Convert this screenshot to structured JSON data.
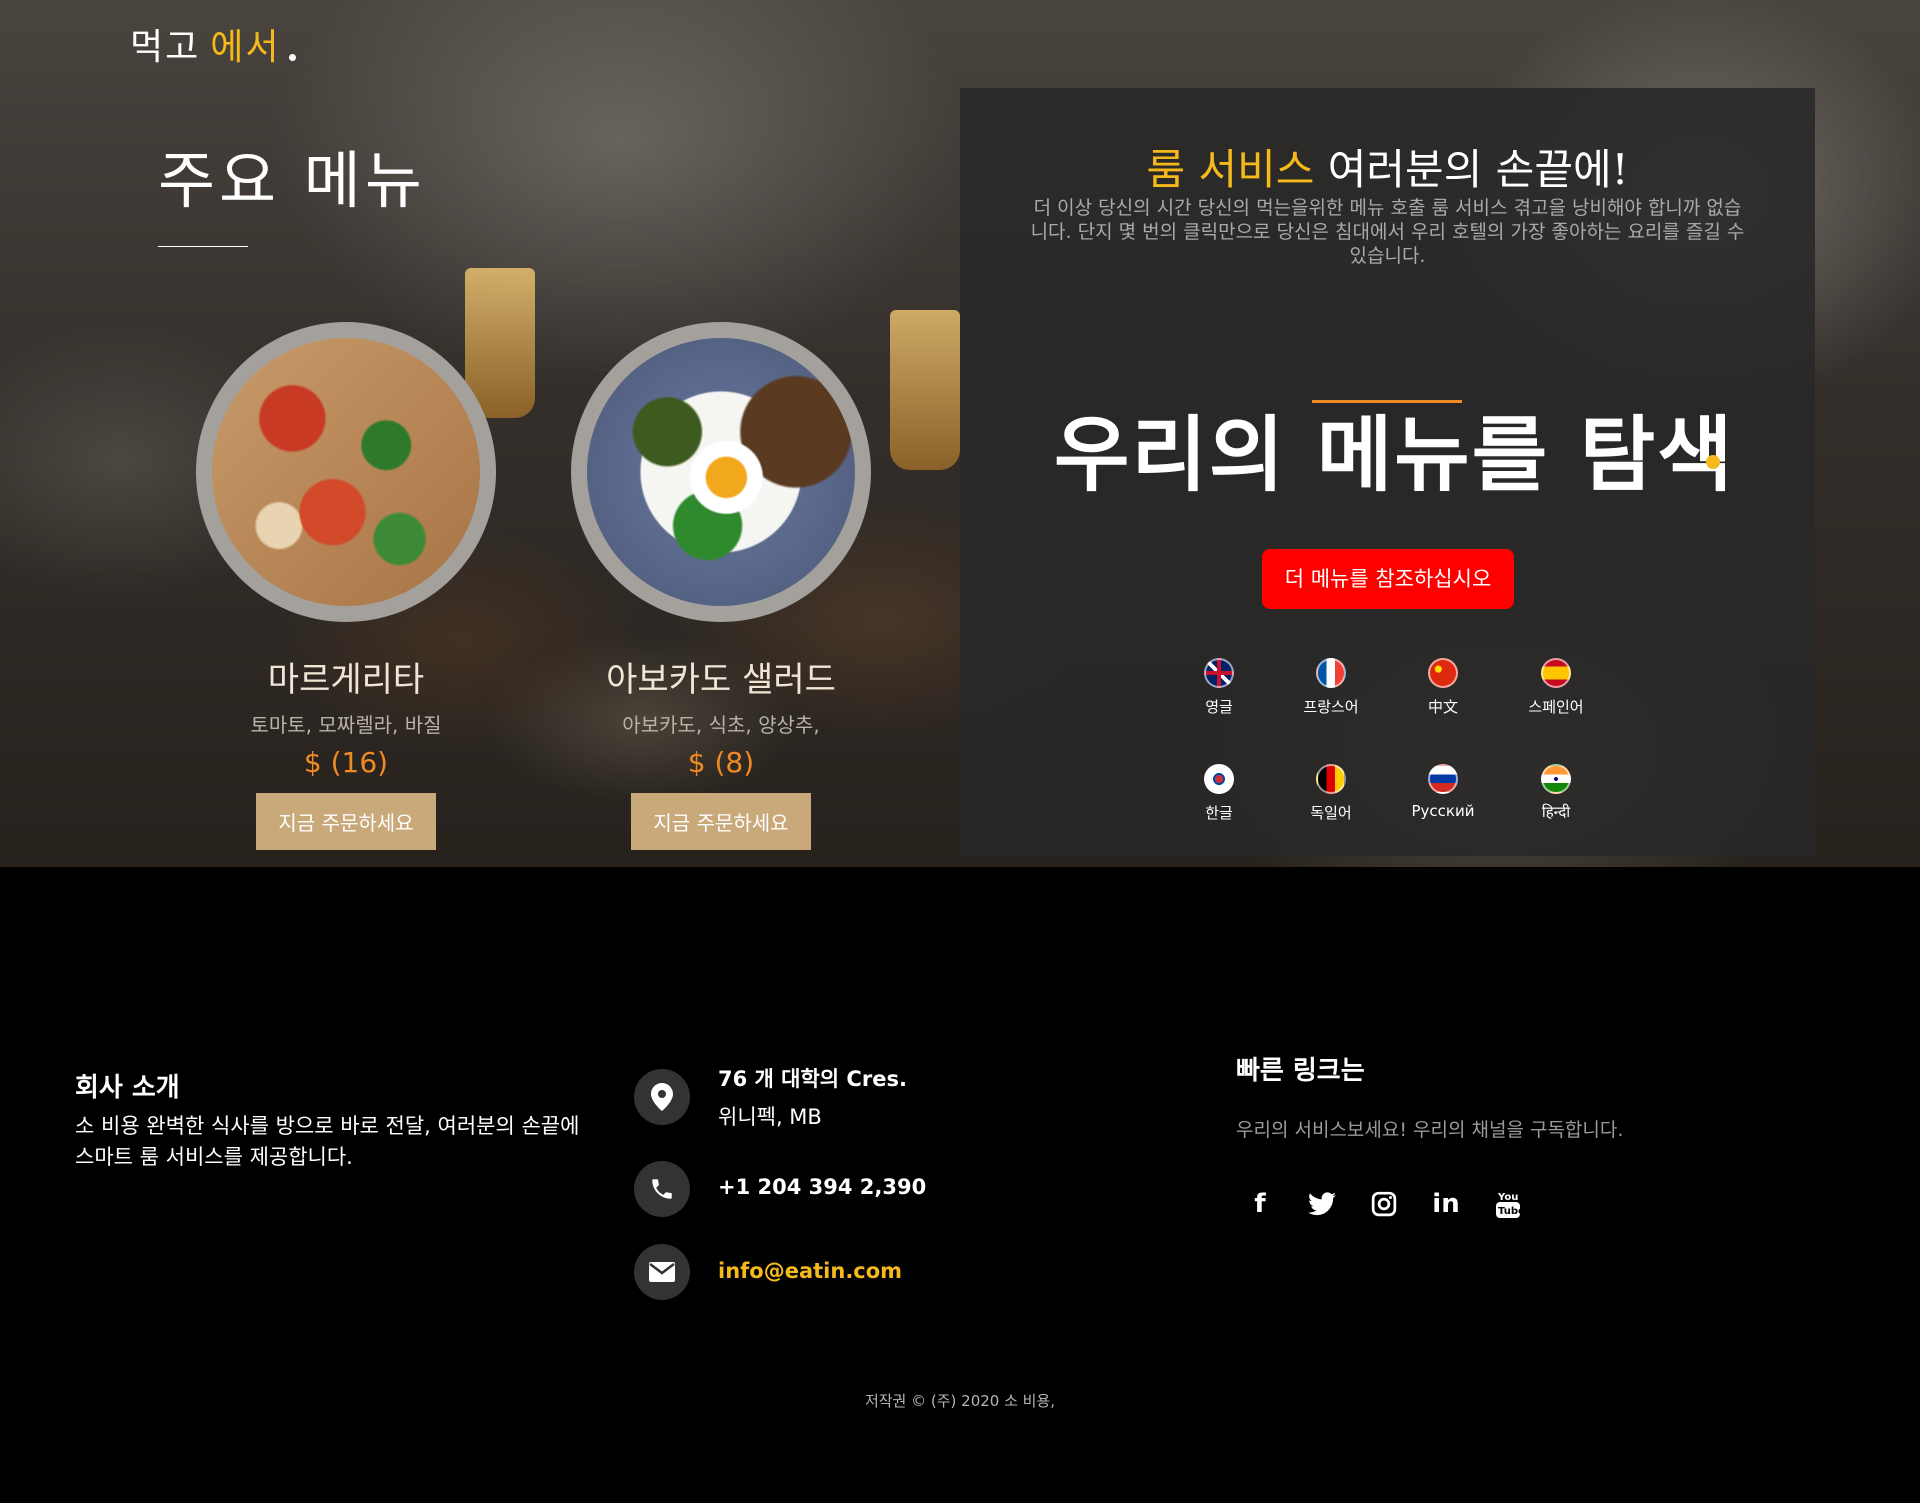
{
  "brand": {
    "part1": "먹고",
    "part2": "에서"
  },
  "menu": {
    "title": "주요 메뉴",
    "dishes": [
      {
        "name": "마르게리타",
        "description": "토마토, 모짜렐라, 바질",
        "price": "$ (16)",
        "button": "지금 주문하세요",
        "image": "pizza"
      },
      {
        "name": "아보카도 샐러드",
        "description": "아보카도, 식초, 양상추,",
        "price": "$ (8)",
        "button": "지금 주문하세요",
        "image": "salad"
      }
    ]
  },
  "room_service": {
    "heading_highlight": "룸 서비스",
    "heading_rest": " 여러분의 손끝에!",
    "description": "더 이상 당신의 시간 당신의 먹는을위한 메뉴 호출 룸 서비스 겪고을 낭비해야 합니까 없습니다. 단지 몇 번의 클릭만으로 당신은 침대에서 우리 호텔의 가장 좋아하는 요리를 즐길 수 있습니다.",
    "explore_title": "우리의 메뉴를 탐색",
    "cta_label": "더 메뉴를 참조하십시오",
    "languages": [
      {
        "label": "영글",
        "flag": "uk-flag"
      },
      {
        "label": "프랑스어",
        "flag": "france-flag"
      },
      {
        "label": "中文",
        "flag": "china-flag"
      },
      {
        "label": "스페인어",
        "flag": "spain-flag"
      },
      {
        "label": "한글",
        "flag": "korea-flag"
      },
      {
        "label": "독일어",
        "flag": "germany-flag"
      },
      {
        "label": "Русский",
        "flag": "russia-flag"
      },
      {
        "label": "हिन्दी",
        "flag": "india-flag"
      }
    ]
  },
  "footer": {
    "about_title": "회사 소개",
    "about_text": "소 비용 완벽한 식사를 방으로 바로 전달, 여러분의 손끝에 스마트 룸 서비스를 제공합니다.",
    "address_line1": "76 개 대학의 Cres.",
    "address_line2": "위니펙, MB",
    "phone": "+1 204 394 2,390",
    "email": "info@eatin.com",
    "links_title": "빠른 링크는",
    "links_text": "우리의 서비스보세요! 우리의 채널을 구독합니다.",
    "social": [
      "facebook-icon",
      "twitter-icon",
      "instagram-icon",
      "linkedin-icon",
      "youtube-icon"
    ],
    "copyright": "저작권 © (주) 2020 소 비용,"
  },
  "colors": {
    "accent": "#f5b91c",
    "orange": "#f08a24",
    "cta": "#ff0000",
    "order_button": "#c9a87a"
  }
}
